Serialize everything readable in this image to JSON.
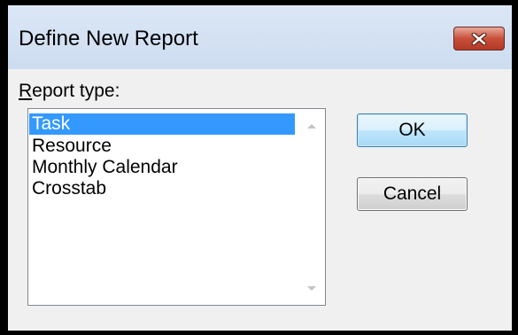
{
  "dialog": {
    "title": "Define New Report",
    "close_icon": "close-icon",
    "label_accel": "R",
    "label_rest": "eport type:",
    "items": [
      "Task",
      "Resource",
      "Monthly Calendar",
      "Crosstab"
    ],
    "selected_item": "Task",
    "ok_label": "OK",
    "cancel_label": "Cancel"
  },
  "colors": {
    "selection": "#3399ff",
    "close_button": "#c8503b"
  }
}
